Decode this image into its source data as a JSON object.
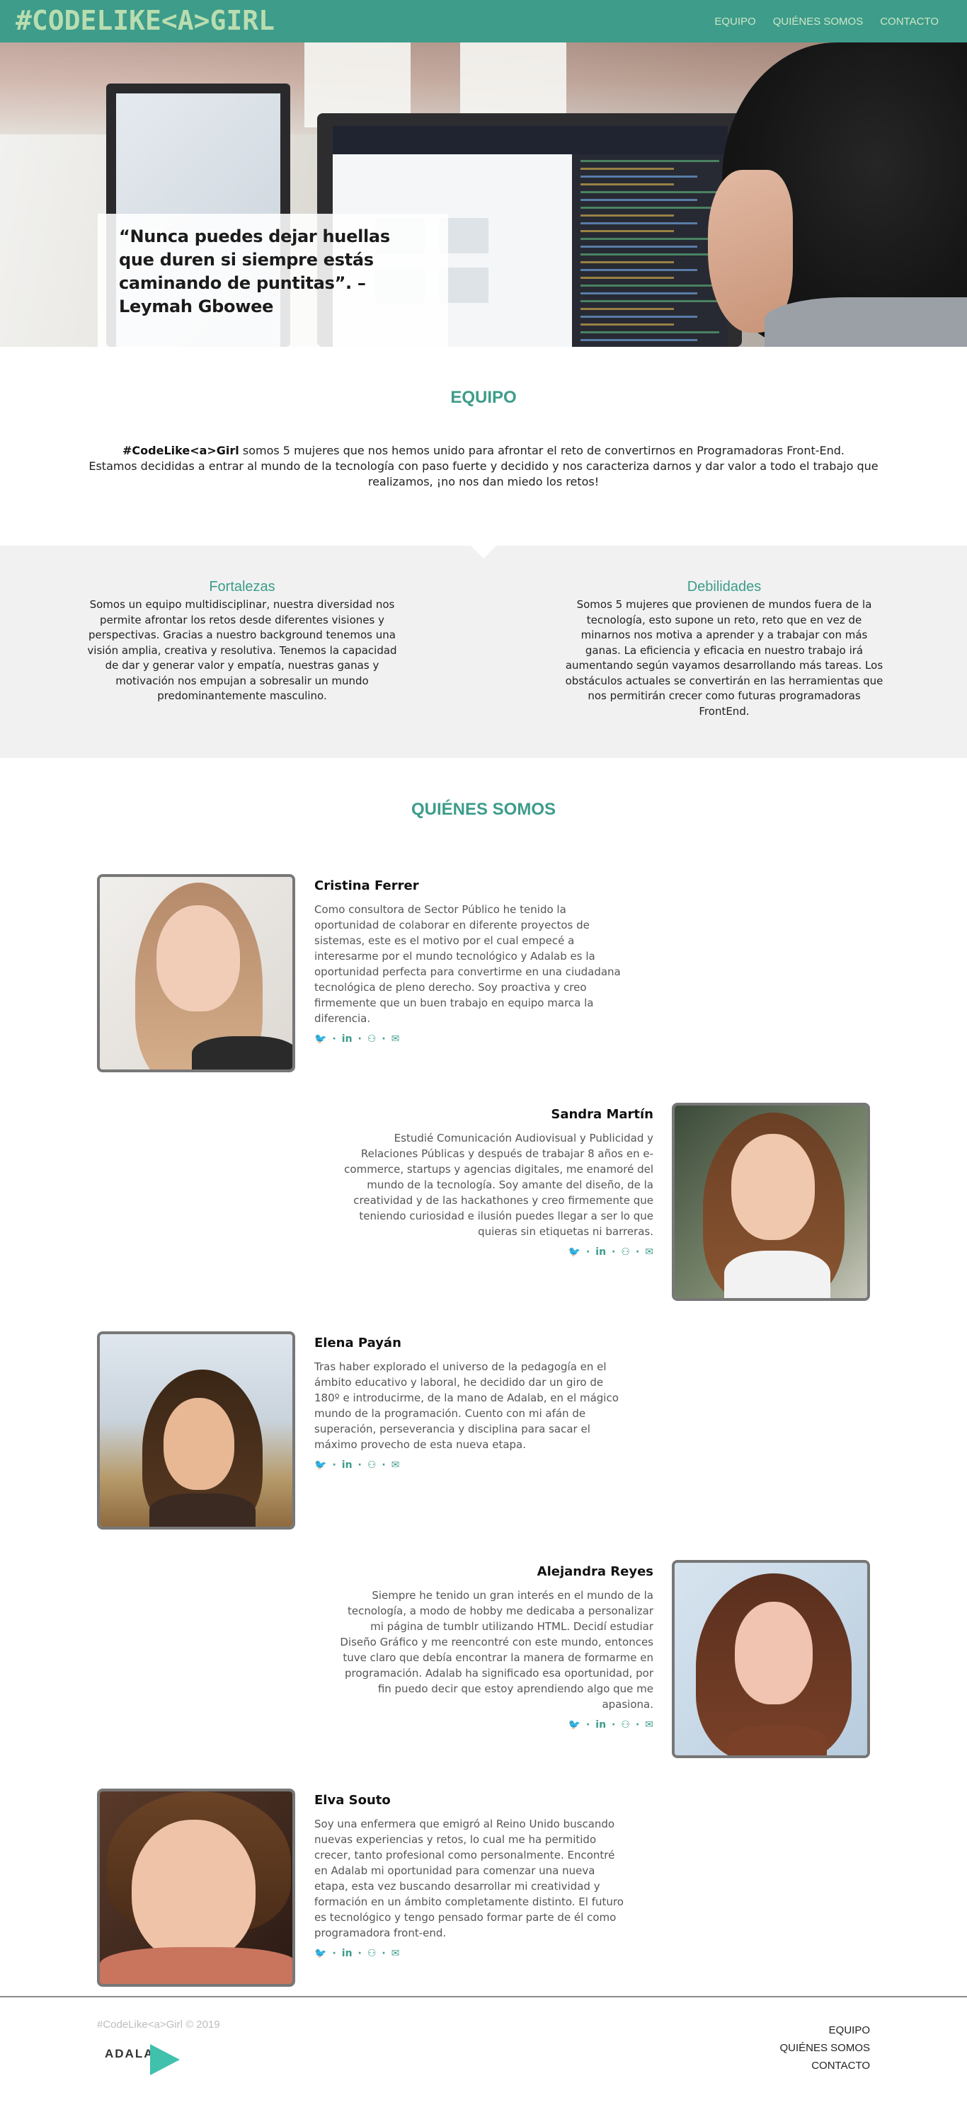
{
  "header": {
    "logo": "#CODELIKE<A>GIRL",
    "nav": [
      "EQUIPO",
      "QUIÉNES SOMOS",
      "CONTACTO"
    ]
  },
  "hero": {
    "quote": "“Nunca puedes dejar huellas que duren si siempre estás caminando de puntitas”. – Leymah Gbowee"
  },
  "equipo": {
    "title": "EQUIPO",
    "intro_brand": "#CodeLike<a>Girl",
    "intro_rest": " somos 5 mujeres que nos hemos unido para afrontar el reto de convertirnos en Programadoras Front-End.",
    "intro_line2": "Estamos decididas a entrar al mundo de la tecnología con paso fuerte y decidido y nos caracteriza darnos y dar valor a todo el trabajo que realizamos, ¡no nos dan miedo los retos!",
    "strengths_title": "Fortalezas",
    "strengths_text": "Somos un equipo multidisciplinar, nuestra diversidad nos permite afrontar los retos desde diferentes visiones y perspectivas. Gracias a nuestro background tenemos una visión amplia, creativa y resolutiva. Tenemos la capacidad de dar y generar valor y empatía, nuestras ganas y motivación nos empujan a sobresalir un mundo predominantemente masculino.",
    "weaknesses_title": "Debilidades",
    "weaknesses_text": "Somos 5 mujeres que provienen de mundos fuera de la tecnología, esto supone un reto, reto que en vez de minarnos nos motiva a aprender y a trabajar con más ganas. La eficiencia y eficacia en nuestro trabajo irá aumentando según vayamos desarrollando más tareas. Los obstáculos actuales se convertirán en las herramientas que nos permitirán crecer como futuras programadoras FrontEnd."
  },
  "quienes": {
    "title": "QUIÉNES SOMOS",
    "members": [
      {
        "name": "Cristina Ferrer",
        "bio": "Como consultora de Sector Público he tenido la oportunidad de colaborar en diferente proyectos de sistemas, este es el motivo por el cual empecé a interesarme por el mundo tecnológico y Adalab es la oportunidad perfecta para convertirme en una ciudadana tecnológica de pleno derecho. Soy proactiva y creo firmemente que un buen trabajo en equipo marca la diferencia."
      },
      {
        "name": "Sandra Martín",
        "bio": "Estudié Comunicación Audiovisual y Publicidad y Relaciones Públicas y después de trabajar 8 años en e-commerce, startups y agencias digitales, me enamoré del mundo de la tecnología. Soy amante del diseño, de la creatividad y de las hackathones y creo firmemente que teniendo curiosidad e ilusión puedes llegar a ser lo que quieras sin etiquetas ni barreras."
      },
      {
        "name": "Elena Payán",
        "bio": "Tras haber explorado el universo de la pedagogía en el ámbito educativo y laboral, he decidido dar un giro de 180º e introducirme, de la mano de Adalab, en el mágico mundo de la programación. Cuento con mi afán de superación, perseverancia y disciplina para sacar el máximo provecho de esta nueva etapa."
      },
      {
        "name": "Alejandra Reyes",
        "bio": "Siempre he tenido un gran interés en el mundo de la tecnología, a modo de hobby me dedicaba a personalizar mi página de tumblr utilizando HTML. Decidí estudiar Diseño Gráfico y me reencontré con este mundo, entonces tuve claro que debía encontrar la manera de formarme en programación. Adalab ha significado esa oportunidad, por fin puedo decir que estoy aprendiendo algo que me apasiona."
      },
      {
        "name": "Elva Souto",
        "bio": "Soy una enfermera que emigró al Reino Unido buscando nuevas experiencias y retos, lo cual me ha permitido crecer, tanto profesional como personalmente. Encontré en Adalab mi oportunidad para comenzar una nueva etapa, esta vez buscando desarrollar mi creatividad y formación en un ámbito completamente distinto. El futuro es tecnológico y tengo pensado formar parte de él como programadora front-end."
      }
    ],
    "social_icons": [
      "twitter-icon",
      "linkedin-icon",
      "github-icon",
      "email-icon"
    ]
  },
  "footer": {
    "copyright": "#CodeLike<a>Girl © 2019",
    "brand": "ADALAB",
    "nav": [
      "EQUIPO",
      "QUIÉNES SOMOS",
      "CONTACTO"
    ]
  },
  "colors": {
    "accent": "#3d9c8a",
    "header_bg": "#3d9c8a",
    "logo": "#b9ddb0",
    "band_bg": "#f1f1f1"
  }
}
